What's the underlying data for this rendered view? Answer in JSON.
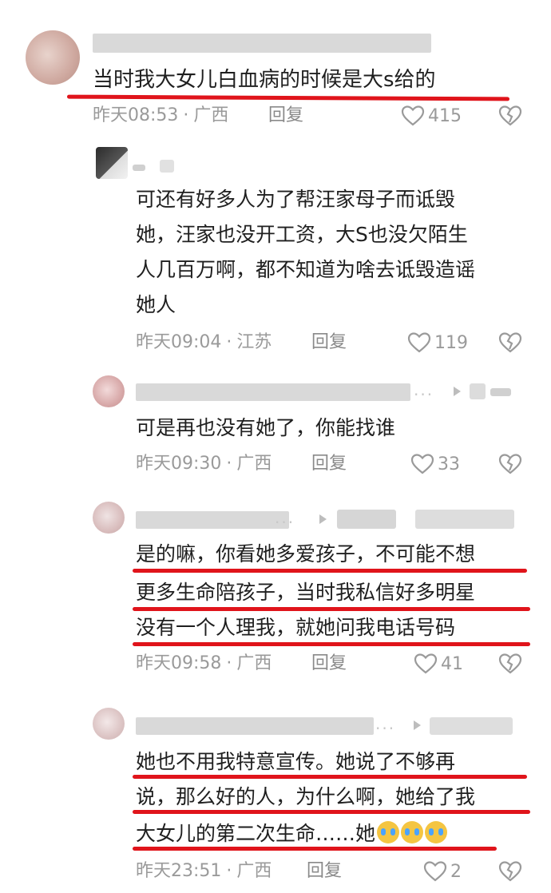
{
  "comments": [
    {
      "text_lines": [
        "当时我大女儿白血病的时候是大s给的"
      ],
      "time": "昨天08:53",
      "location": "广西",
      "reply": "回复",
      "likes": "415"
    },
    {
      "text_lines": [
        "可还有好多人为了帮汪家母子而诋毁",
        "她，汪家也没开工资，大S也没欠陌生",
        "人几百万啊，都不知道为啥去诋毁造谣",
        "她人"
      ],
      "time": "昨天09:04",
      "location": "江苏",
      "reply": "回复",
      "likes": "119"
    },
    {
      "text_lines": [
        "可是再也没有她了，你能找谁"
      ],
      "time": "昨天09:30",
      "location": "广西",
      "reply": "回复",
      "likes": "33"
    },
    {
      "text_lines": [
        "是的嘛，你看她多爱孩子，不可能不想",
        "更多生命陪孩子，当时我私信好多明星",
        "没有一个人理我，就她问我电话号码"
      ],
      "time": "昨天09:58",
      "location": "广西",
      "reply": "回复",
      "likes": "41"
    },
    {
      "text_lines": [
        "她也不用我特意宣传。她说了不够再",
        "说，那么好的人，为什么啊，她给了我",
        "大女儿的第二次生命……她"
      ],
      "time": "昨天23:51",
      "location": "广西",
      "reply": "回复",
      "likes": "2"
    }
  ],
  "meta_separator": "·",
  "colors": {
    "underline": "#e0141b",
    "meta_text": "#9a9a9a",
    "body_text": "#1f1f1f"
  },
  "icons": {
    "like": "heart-outline-icon",
    "dislike": "broken-heart-icon",
    "emoji": "crying-face-emoji"
  }
}
